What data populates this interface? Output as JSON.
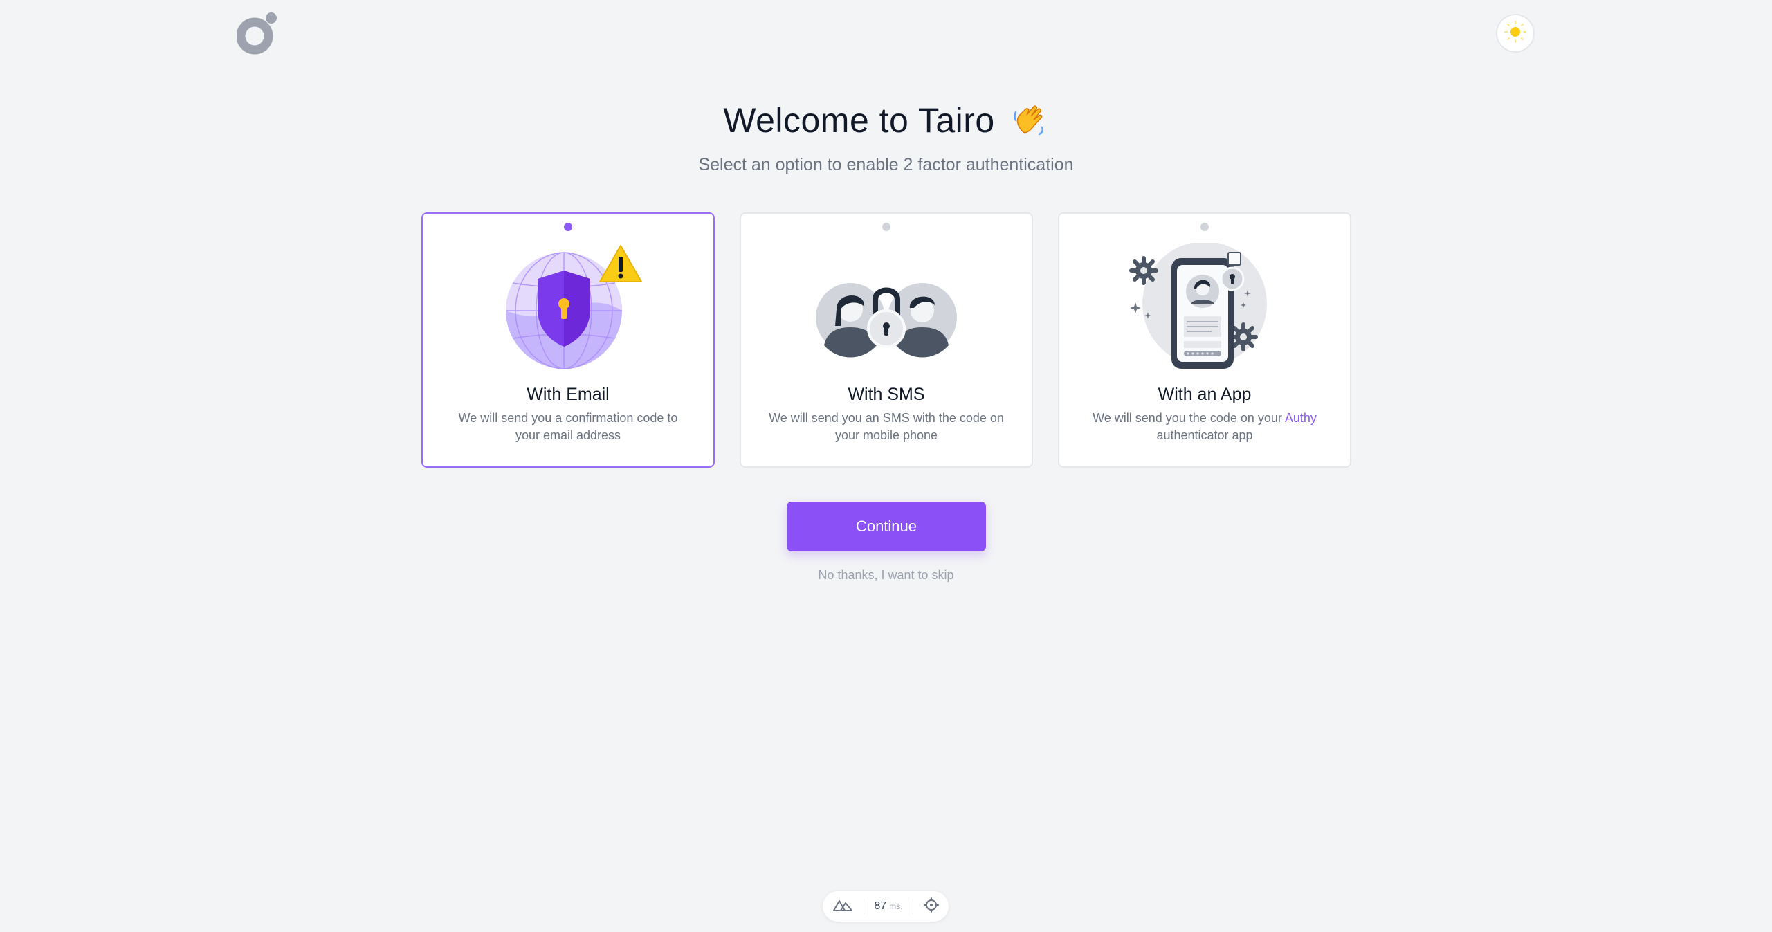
{
  "header": {
    "logo_icon": "tairo-logo-icon",
    "theme_icon": "sun-icon"
  },
  "hero": {
    "title": "Welcome to Tairo",
    "title_emoji_icon": "waving-hand-icon",
    "subtitle": "Select an option to enable 2 factor authentication"
  },
  "options": [
    {
      "title": "With Email",
      "description": "We will send you a confirmation code to your email address",
      "selected": true,
      "illustration_icon": "shield-globe-illustration"
    },
    {
      "title": "With SMS",
      "description": "We will send you an SMS with the code on your mobile phone",
      "selected": false,
      "illustration_icon": "people-lock-illustration"
    },
    {
      "title": "With an App",
      "description_before": "We will send you the code on your",
      "description_link": "Authy",
      "description_after": "authenticator app",
      "selected": false,
      "illustration_icon": "phone-app-illustration"
    }
  ],
  "actions": {
    "continue_label": "Continue",
    "skip_label": "No thanks, I want to skip"
  },
  "devtools": {
    "render_time": "87",
    "render_unit": "ms."
  },
  "colors": {
    "accent": "#8b5cf6",
    "button": "#8b50f6",
    "background": "#f3f4f6"
  }
}
